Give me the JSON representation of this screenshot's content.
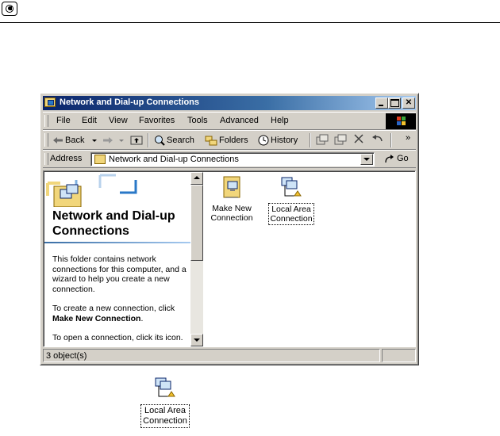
{
  "window": {
    "title": "Network and Dial-up Connections",
    "controls": {
      "minimize": "minimize",
      "maximize": "maximize",
      "close": "✕"
    }
  },
  "menu": [
    "File",
    "Edit",
    "View",
    "Favorites",
    "Tools",
    "Advanced",
    "Help"
  ],
  "toolbar": {
    "back": "Back",
    "search": "Search",
    "folders": "Folders",
    "history": "History",
    "more": "»"
  },
  "address": {
    "label": "Address",
    "value": "Network and Dial-up Connections",
    "go": "Go"
  },
  "left_pane": {
    "title": "Network and Dial-up Connections",
    "para1": "This folder contains network connections for this computer, and a wizard to help you create a new connection.",
    "para2_prefix": "To create a new connection, click",
    "para2_bold": "Make New Connection",
    "para2_suffix": ".",
    "para3": "To open a connection, click its icon."
  },
  "items": [
    {
      "label_line1": "Make New",
      "label_line2": "Connection",
      "icon": "make-new-connection-icon"
    },
    {
      "label_line1": "Local Area",
      "label_line2": "Connection",
      "icon": "local-area-connection-icon"
    }
  ],
  "status": {
    "text": "3 object(s)"
  },
  "standalone_icon": {
    "label_line1": "Local Area",
    "label_line2": "Connection",
    "icon": "local-area-connection-icon"
  },
  "colors": {
    "titlebar_start": "#0a246a",
    "titlebar_end": "#a6caf0",
    "face": "#d4d0c8"
  }
}
